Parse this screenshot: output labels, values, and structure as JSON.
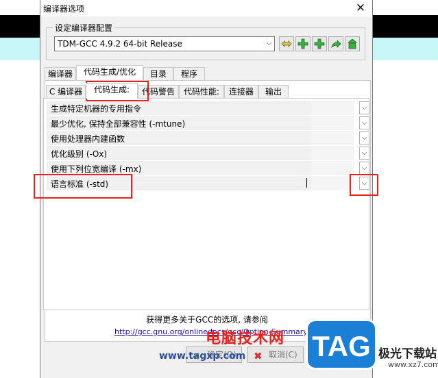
{
  "window": {
    "title": "编译器选项",
    "close_symbol": "✕"
  },
  "config_group": {
    "label": "设定编译器配置",
    "selected": "TDM-GCC 4.9.2 64-bit Release",
    "dropdown_arrow": "⌵"
  },
  "toolbar_icons": [
    "rename-icon",
    "add-icon",
    "add-new-icon",
    "copy-icon",
    "delete-icon"
  ],
  "main_tabs": [
    {
      "label": "编译器"
    },
    {
      "label": "代码生成/优化"
    },
    {
      "label": "目录"
    },
    {
      "label": "程序"
    }
  ],
  "sub_tabs": [
    {
      "label": "C 编译器"
    },
    {
      "label": "代码生成:"
    },
    {
      "label": "代码警告"
    },
    {
      "label": "代码性能:"
    },
    {
      "label": "连接器"
    },
    {
      "label": "输出"
    }
  ],
  "options": [
    {
      "label": "生成特定机器的专用指令"
    },
    {
      "label": "最少优化, 保持全部兼容性 (-mtune)"
    },
    {
      "label": "使用处理器内建函数"
    },
    {
      "label": "优化级别 (-Ox)"
    },
    {
      "label": "使用下列位宽编译 (-mx)"
    },
    {
      "label": "语言标准 (-std)"
    }
  ],
  "dropdown_arrow": "⌵",
  "footer": {
    "hint": "获得更多关于GCC的选项, 请参阅",
    "link": "http://gcc.gnu.org/onlinedocs/gcc/Option-Summary.html",
    "ok_label": "确定(O)",
    "cancel_label": "取消(C)"
  },
  "watermark": {
    "site_cn": "电脑技术网",
    "url": "www.tagxp.com",
    "logo": "TAG",
    "right_text": "极光下载站",
    "right_url": "www.xz7.com"
  },
  "colors": {
    "highlight": "#e8211c",
    "watermark_blue": "#1c7fd6"
  }
}
